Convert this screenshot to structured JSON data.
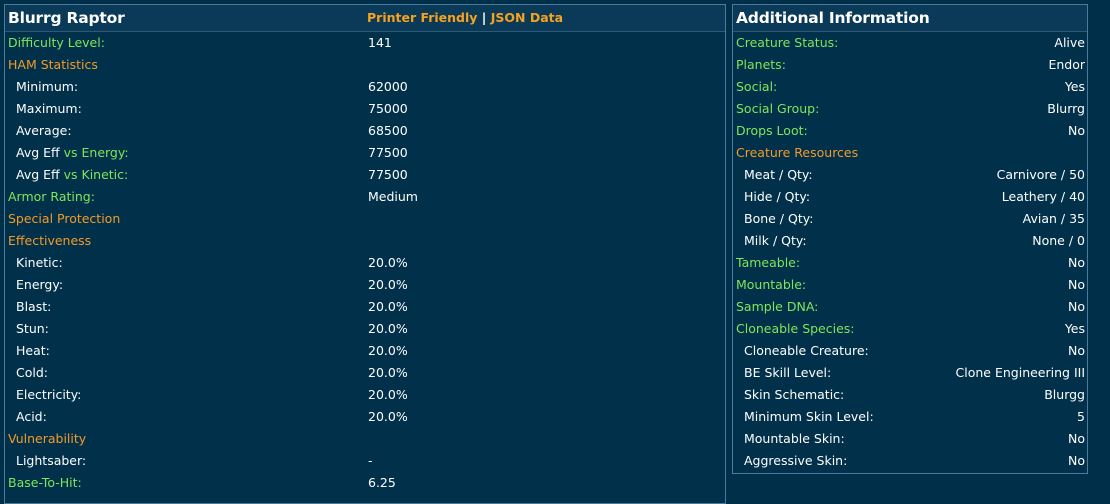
{
  "left": {
    "title": "Blurrg Raptor",
    "link_printer": "Printer Friendly",
    "link_sep": "|",
    "link_json": "JSON Data",
    "rows": [
      {
        "label": "Difficulty Level:",
        "value": "141"
      },
      {
        "label": "HAM Statistics",
        "value": ""
      },
      {
        "label": "Minimum:",
        "value": "62000"
      },
      {
        "label": "Maximum:",
        "value": "75000"
      },
      {
        "label": "Average:",
        "value": "68500"
      },
      {
        "label_prefix": "Avg Eff ",
        "label_suffix": "vs Energy:",
        "value": "77500"
      },
      {
        "label_prefix": "Avg Eff ",
        "label_suffix": "vs Kinetic:",
        "value": "77500"
      },
      {
        "label": "Armor Rating:",
        "value": "Medium"
      },
      {
        "label": "Special Protection",
        "value": ""
      },
      {
        "label": "Effectiveness",
        "value": ""
      },
      {
        "label": "Kinetic:",
        "value": "20.0%"
      },
      {
        "label": "Energy:",
        "value": "20.0%"
      },
      {
        "label": "Blast:",
        "value": "20.0%"
      },
      {
        "label": "Stun:",
        "value": "20.0%"
      },
      {
        "label": "Heat:",
        "value": "20.0%"
      },
      {
        "label": "Cold:",
        "value": "20.0%"
      },
      {
        "label": "Electricity:",
        "value": "20.0%"
      },
      {
        "label": "Acid:",
        "value": "20.0%"
      },
      {
        "label": "Vulnerability",
        "value": ""
      },
      {
        "label": "Lightsaber:",
        "value": "-"
      },
      {
        "label": "Base-To-Hit:",
        "value": "6.25"
      }
    ]
  },
  "right": {
    "title": "Additional Information",
    "rows": [
      {
        "label": "Creature Status:",
        "value": "Alive"
      },
      {
        "label": "Planets:",
        "value": "Endor"
      },
      {
        "label": "Social:",
        "value": "Yes"
      },
      {
        "label": "Social Group:",
        "value": "Blurrg"
      },
      {
        "label": "Drops Loot:",
        "value": "No"
      },
      {
        "label": "Creature Resources",
        "value": ""
      },
      {
        "label": "Meat / Qty:",
        "value": "Carnivore / 50"
      },
      {
        "label": "Hide / Qty:",
        "value": "Leathery / 40"
      },
      {
        "label": "Bone / Qty:",
        "value": "Avian / 35"
      },
      {
        "label": "Milk / Qty:",
        "value": "None / 0"
      },
      {
        "label": "Tameable:",
        "value": "No"
      },
      {
        "label": "Mountable:",
        "value": "No"
      },
      {
        "label": "Sample DNA:",
        "value": "No"
      },
      {
        "label": "Cloneable Species:",
        "value": "Yes"
      },
      {
        "label": "Cloneable Creature:",
        "value": "No"
      },
      {
        "label": "BE Skill Level:",
        "value": "Clone Engineering III"
      },
      {
        "label": "Skin Schematic:",
        "value": "Blurgg"
      },
      {
        "label": "Minimum Skin Level:",
        "value": "5"
      },
      {
        "label": "Mountable Skin:",
        "value": "No"
      },
      {
        "label": "Aggressive Skin:",
        "value": "No"
      }
    ]
  },
  "colors": {
    "background": "#003049",
    "label_green": "#7ee75a",
    "section_orange": "#f39b2a",
    "link_orange": "#f6a21e",
    "text_white": "#ffffff"
  }
}
